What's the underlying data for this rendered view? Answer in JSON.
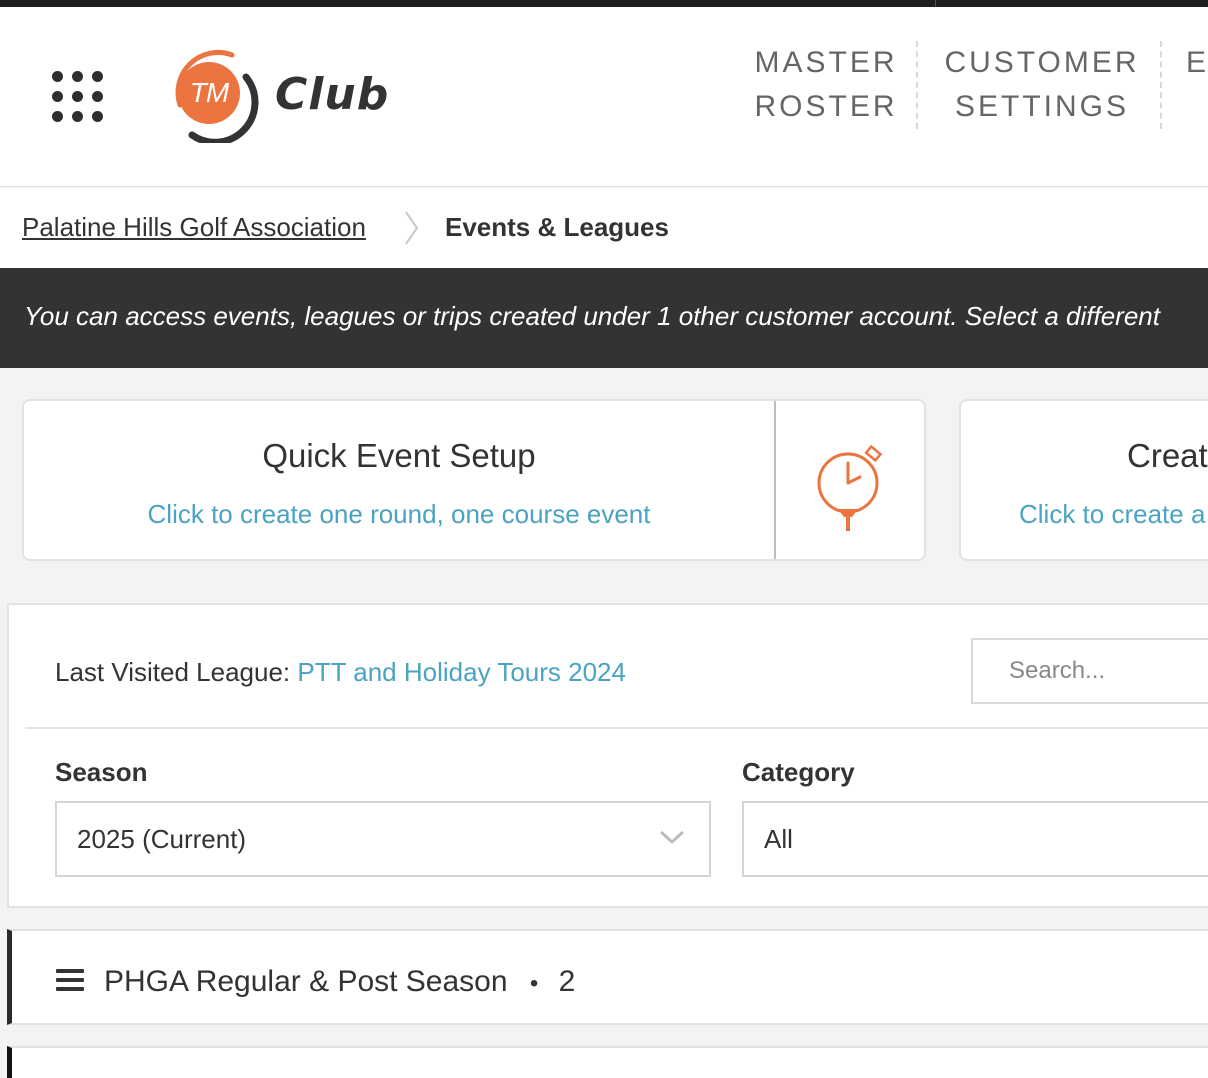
{
  "app": {
    "logo_badge": "TM",
    "logo_name": "Club"
  },
  "nav": {
    "items": [
      {
        "line1": "MASTER",
        "line2": "ROSTER"
      },
      {
        "line1": "CUSTOMER",
        "line2": "SETTINGS"
      },
      {
        "line1": "E",
        "line2": ""
      }
    ]
  },
  "breadcrumb": {
    "parent": "Palatine Hills Golf Association",
    "current": "Events & Leagues"
  },
  "banner": {
    "text": "You can access events, leagues or trips created under 1 other customer account. Select a different"
  },
  "cards": {
    "quick": {
      "title": "Quick Event Setup",
      "subtitle": "Click to create one round, one course event",
      "icon": "stopwatch-golf-tee-icon"
    },
    "create": {
      "title": "Creat",
      "subtitle": "Click to create a"
    }
  },
  "filters": {
    "last_visited_label": "Last Visited League:",
    "last_visited_link": "PTT and Holiday Tours 2024",
    "search_placeholder": "Search...",
    "season_label": "Season",
    "season_value": "2025 (Current)",
    "category_label": "Category",
    "category_value": "All"
  },
  "group": {
    "title": "PHGA Regular & Post Season",
    "bullet": "•",
    "count": "2"
  },
  "colors": {
    "accent_orange": "#ec7440",
    "link_blue": "#4aa3c2",
    "banner_bg": "#333333"
  }
}
